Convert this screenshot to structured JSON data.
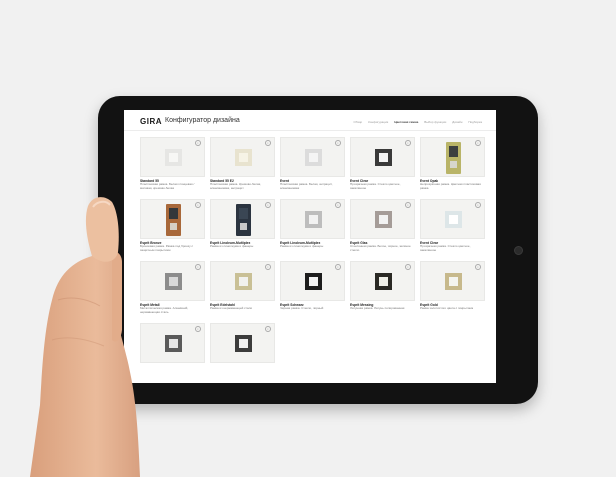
{
  "app": {
    "logo": "GIRA",
    "title": "Конфигуратор дизайна"
  },
  "steps": [
    {
      "label": "Обзор",
      "active": false
    },
    {
      "label": "Конфигурация",
      "active": false
    },
    {
      "label": "Цветовая гамма",
      "active": true
    },
    {
      "label": "Выбор функции",
      "active": false
    },
    {
      "label": "Дизайн",
      "active": false
    },
    {
      "label": "Подборка",
      "active": false
    }
  ],
  "products": [
    {
      "title": "Standard 55",
      "desc": "Пластиковая рамка. Белая глянцевая / матовая, кремово-белая",
      "frame": "#e6e6e4",
      "inner": "#f7f7f5",
      "tall": false
    },
    {
      "title": "Standard 55 E2",
      "desc": "Пластиковая рамка. Кремово-белая, алюминиевая, антрацит",
      "frame": "#e8e3cf",
      "inner": "#f6f3e6",
      "tall": false
    },
    {
      "title": "Event",
      "desc": "Пластиковая рамка. Белая, антрацит, алюминиевая",
      "frame": "#dcdcdc",
      "inner": "#f4f4f4",
      "tall": false
    },
    {
      "title": "Event Clear",
      "desc": "Прозрачная рамка. Стекло цветное, закалённое",
      "frame": "#3a3a3a",
      "inner": "#f4f4f4",
      "tall": false
    },
    {
      "title": "Event Opak",
      "desc": "Непрозрачная рамка. Цветная пластиковая рамка",
      "frame": "#b9b468",
      "inner": "#3b3e3f",
      "tall": true,
      "inner2": "#d7d6cc"
    },
    {
      "title": "Esprit Bronze",
      "desc": "Бронзовая рамка. Рамка под бронзу с защитным покрытием",
      "frame": "#a8683a",
      "inner": "#33373a",
      "tall": true,
      "inner2": "#d6d0c6"
    },
    {
      "title": "Esprit Linoleum-Multiplex",
      "desc": "Рамка из линолеума и фанеры",
      "frame": "#2b3440",
      "inner": "#3a4654",
      "tall": true,
      "inner2": "#c8c8c8"
    },
    {
      "title": "Esprit Linoleum-Multiplex",
      "desc": "Рамка из линолеума и фанеры",
      "frame": "#bdbdbd",
      "inner": "#f2f2f2",
      "tall": false
    },
    {
      "title": "Esprit Glas",
      "desc": "Стеклянная рамка. Белое, чёрное, зелёное стекло",
      "frame": "#a59c98",
      "inner": "#f2f2f2",
      "tall": false
    },
    {
      "title": "Event Clear",
      "desc": "Прозрачная рамка. Стекло цветное, закалённое",
      "frame": "#dde6e8",
      "inner": "#ffffff",
      "tall": false
    },
    {
      "title": "Esprit Metall",
      "desc": "Металлическая рамка. Алюминий, нержавеющая сталь",
      "frame": "#8c8c8c",
      "inner": "#d8d8d8",
      "tall": false
    },
    {
      "title": "Esprit Edelstahl",
      "desc": "Рамка из нержавеющей стали",
      "frame": "#c9c096",
      "inner": "#f1f1ee",
      "tall": false
    },
    {
      "title": "Esprit Schwarz",
      "desc": "Чёрная рамка. Стекло, чёрный",
      "frame": "#1d1d1d",
      "inner": "#f2f2f2",
      "tall": false
    },
    {
      "title": "Esprit Messing",
      "desc": "Латунная рамка. Латунь полированная",
      "frame": "#2a2924",
      "inner": "#efefe8",
      "tall": false
    },
    {
      "title": "Esprit Gold",
      "desc": "Рамка золотистого цвета с покрытием",
      "frame": "#c7b98c",
      "inner": "#f4f4ef",
      "tall": false
    },
    {
      "title": "",
      "desc": "",
      "frame": "#5a5a5a",
      "inner": "#e6e6e6",
      "tall": false
    },
    {
      "title": "",
      "desc": "",
      "frame": "#3c3c3c",
      "inner": "#f0f0f0",
      "tall": false
    }
  ],
  "colors": {
    "background": "#f1f1f1",
    "tablet": "#121212",
    "skin": "#e7b493"
  }
}
